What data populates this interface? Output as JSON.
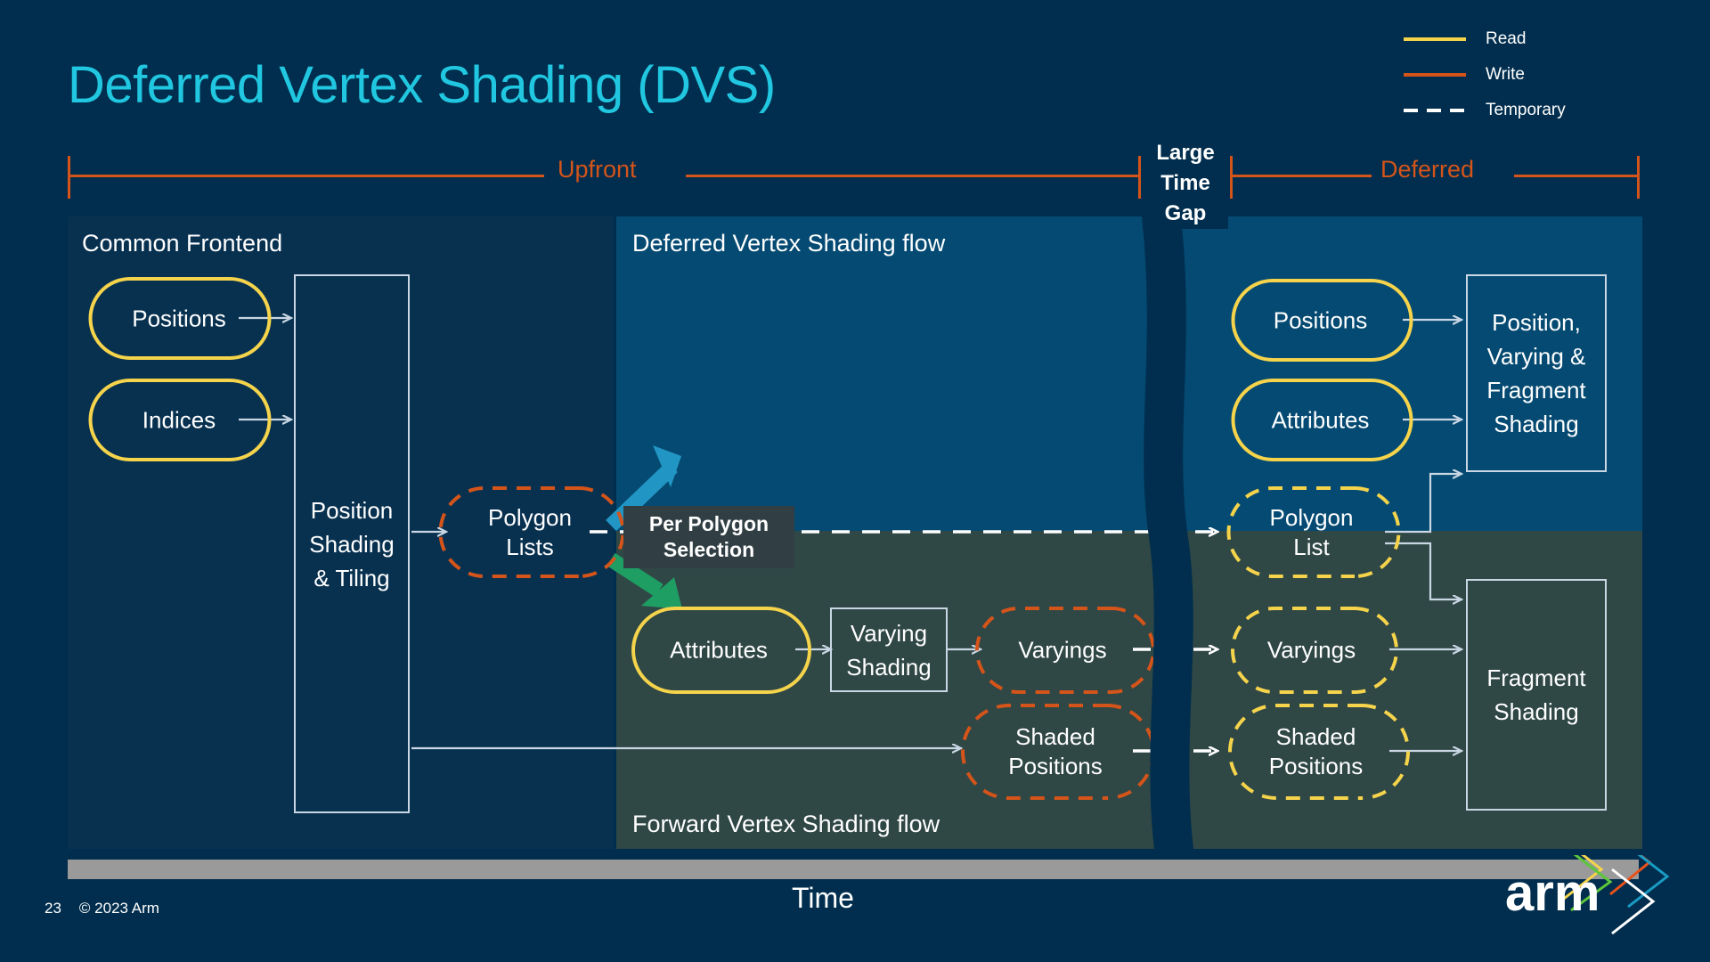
{
  "slide": {
    "title": "Deferred Vertex Shading (DVS)",
    "page_number": "23",
    "copyright": "© 2023 Arm",
    "time_axis_label": "Time",
    "logo_text": "arm"
  },
  "legend": {
    "items": [
      {
        "label": "Read",
        "style": "solid",
        "color": "#F5D44C",
        "icon": "line-solid-icon"
      },
      {
        "label": "Write",
        "style": "solid",
        "color": "#D4541A",
        "icon": "line-solid-icon"
      },
      {
        "label": "Temporary",
        "style": "dashed",
        "color": "#FFFFFF",
        "icon": "line-dashed-icon"
      }
    ]
  },
  "timeline": {
    "upfront_label": "Upfront",
    "gap_label": "Large\nTime\nGap",
    "gap_label_lines": [
      "Large",
      "Time",
      "Gap"
    ],
    "deferred_label": "Deferred",
    "bracket_color": "#D4541A"
  },
  "panels": {
    "frontend": {
      "title": "Common Frontend",
      "bg": "#083150"
    },
    "dvs": {
      "title": "Deferred Vertex Shading flow",
      "bg": "#054A72"
    },
    "forward": {
      "title": "Forward Vertex Shading flow",
      "bg": "#2F4745"
    }
  },
  "nodes": {
    "positions_in": {
      "label": "Positions",
      "kind": "buffer",
      "line": "solid",
      "color": "#F5D44C"
    },
    "indices_in": {
      "label": "Indices",
      "kind": "buffer",
      "line": "solid",
      "color": "#F5D44C"
    },
    "position_shading_tiling": {
      "label": "Position\nShading\n& Tiling",
      "lines": [
        "Position",
        "Shading",
        "& Tiling"
      ],
      "kind": "process"
    },
    "polygon_lists": {
      "label": "Polygon\nLists",
      "lines": [
        "Polygon",
        "Lists"
      ],
      "kind": "buffer",
      "line": "dashed",
      "color": "#D4541A"
    },
    "per_polygon_selection": {
      "label": "Per Polygon\nSelection",
      "lines": [
        "Per Polygon",
        "Selection"
      ],
      "kind": "annotation"
    },
    "attributes_fwd": {
      "label": "Attributes",
      "kind": "buffer",
      "line": "solid",
      "color": "#F5D44C"
    },
    "varying_shading": {
      "label": "Varying\nShading",
      "lines": [
        "Varying",
        "Shading"
      ],
      "kind": "process"
    },
    "varyings_write": {
      "label": "Varyings",
      "kind": "buffer",
      "line": "dashed",
      "color": "#D4541A"
    },
    "shaded_positions_write": {
      "label": "Shaded\nPositions",
      "lines": [
        "Shaded",
        "Positions"
      ],
      "kind": "buffer",
      "line": "dashed",
      "color": "#D4541A"
    },
    "positions_def": {
      "label": "Positions",
      "kind": "buffer",
      "line": "solid",
      "color": "#F5D44C"
    },
    "attributes_def": {
      "label": "Attributes",
      "kind": "buffer",
      "line": "solid",
      "color": "#F5D44C"
    },
    "polygon_list_read": {
      "label": "Polygon\nList",
      "lines": [
        "Polygon",
        "List"
      ],
      "kind": "buffer",
      "line": "dashed",
      "color": "#F5D44C"
    },
    "varyings_read": {
      "label": "Varyings",
      "kind": "buffer",
      "line": "dashed",
      "color": "#F5D44C"
    },
    "shaded_positions_read": {
      "label": "Shaded\nPositions",
      "lines": [
        "Shaded",
        "Positions"
      ],
      "kind": "buffer",
      "line": "dashed",
      "color": "#F5D44C"
    },
    "pvf_shading": {
      "label": "Position,\nVarying &\nFragment\nShading",
      "lines": [
        "Position,",
        "Varying &",
        "Fragment",
        "Shading"
      ],
      "kind": "process"
    },
    "fragment_shading": {
      "label": "Fragment\nShading",
      "lines": [
        "Fragment",
        "Shading"
      ],
      "kind": "process"
    }
  },
  "colors": {
    "background": "#012E4E",
    "title": "#21C7E0",
    "read": "#F5D44C",
    "write": "#D4541A",
    "temporary": "#FFFFFF",
    "arrow": "#C9D7E4",
    "select_up_arrow": "#2196C4",
    "select_down_arrow": "#1E9E63",
    "time_bar": "#9A9A9A"
  }
}
